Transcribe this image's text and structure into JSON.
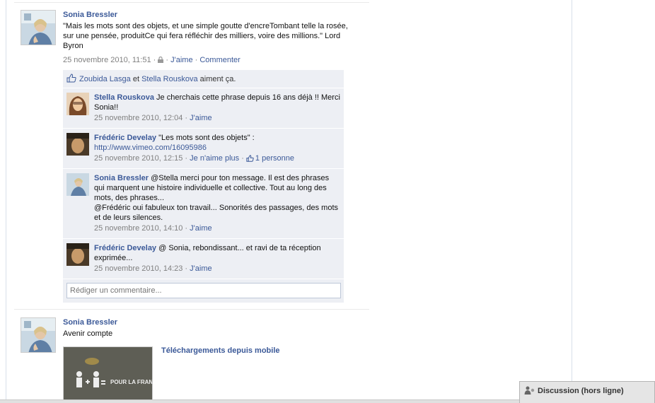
{
  "stories": [
    {
      "author": "Sonia Bressler",
      "message": "\"Mais les mots sont des objets, et une simple goutte d'encreTombant telle la rosée, sur une pensée, produitCe qui fera réfléchir des milliers, voire des millions.\" Lord Byron",
      "timestamp": "25 novembre 2010, 11:51",
      "sep1": " · ",
      "sep2": " · ",
      "like_label": "J'aime",
      "comment_label": "Commenter",
      "likes": {
        "user1": "Zoubida Lasga",
        "and": " et ",
        "user2": "Stella Rouskova",
        "suffix": " aiment ça."
      },
      "comments": [
        {
          "author": "Stella Rouskova",
          "text": " Je cherchais cette phrase depuis 16 ans déjà !! Merci Sonia!!",
          "timestamp": "25 novembre 2010, 12:04",
          "sep": " · ",
          "action": "J'aime"
        },
        {
          "author": "Frédéric Develay",
          "text": " \"Les mots sont des objets\" :",
          "link": "http://www.vimeo.com/16095986",
          "timestamp": "25 novembre 2010, 12:15",
          "sep": " · ",
          "action": "Je n'aime plus",
          "sep2": " · ",
          "like_count": "1 personne"
        },
        {
          "author": "Sonia Bressler",
          "text": " @Stella merci pour ton message. Il est des phrases qui marquent une histoire individuelle et collective. Tout au long des mots, des phrases...",
          "text2": "@Frédéric oui fabuleux ton travail... Sonorités des passages, des mots et de leurs silences.",
          "timestamp": "25 novembre 2010, 14:10",
          "sep": " · ",
          "action": "J'aime"
        },
        {
          "author": "Frédéric Develay",
          "text": " @ Sonia, rebondissant... et ravi de ta réception exprimée...",
          "timestamp": "25 novembre 2010, 14:23",
          "sep": " · ",
          "action": "J'aime"
        }
      ],
      "comment_placeholder": "Rédiger un commentaire..."
    },
    {
      "author": "Sonia Bressler",
      "message": "Avenir compte",
      "attachment_title": "Téléchargements depuis mobile",
      "attachment_image_text": "POUR LA FRANCE"
    }
  ],
  "chat": {
    "label": "Discussion (hors ligne)"
  }
}
